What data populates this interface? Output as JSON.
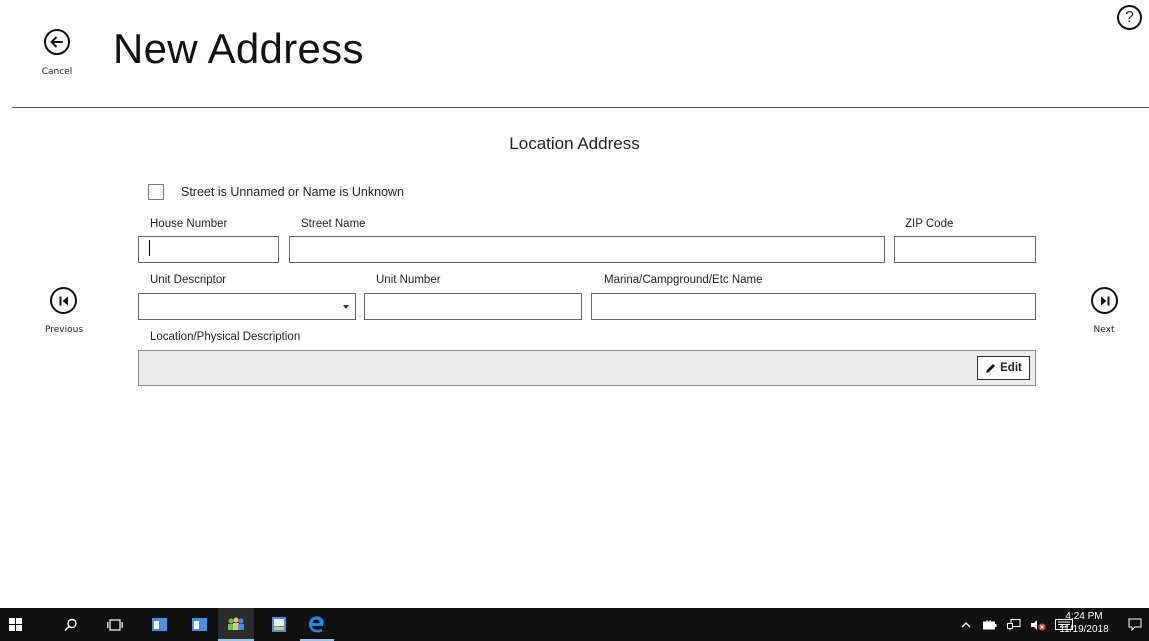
{
  "header": {
    "title": "New Address",
    "cancel_label": "Cancel",
    "help_label": "?"
  },
  "nav": {
    "previous_label": "Previous",
    "next_label": "Next"
  },
  "form": {
    "section_title": "Location Address",
    "unnamed_checkbox": {
      "label": "Street is Unnamed or Name is Unknown",
      "checked": false
    },
    "house_number": {
      "label": "House Number",
      "value": ""
    },
    "street_name": {
      "label": "Street Name",
      "value": ""
    },
    "zip_code": {
      "label": "ZIP Code",
      "value": ""
    },
    "unit_descriptor": {
      "label": "Unit Descriptor",
      "value": ""
    },
    "unit_number": {
      "label": "Unit Number",
      "value": ""
    },
    "marina_name": {
      "label": "Marina/Campground/Etc Name",
      "value": ""
    },
    "location_description": {
      "label": "Location/Physical Description",
      "value": ""
    },
    "edit_label": "Edit"
  },
  "taskbar": {
    "time": "4:24 PM",
    "date": "11/19/2018",
    "colors": {
      "background": "#101010",
      "accent": "#1e88e5"
    }
  }
}
